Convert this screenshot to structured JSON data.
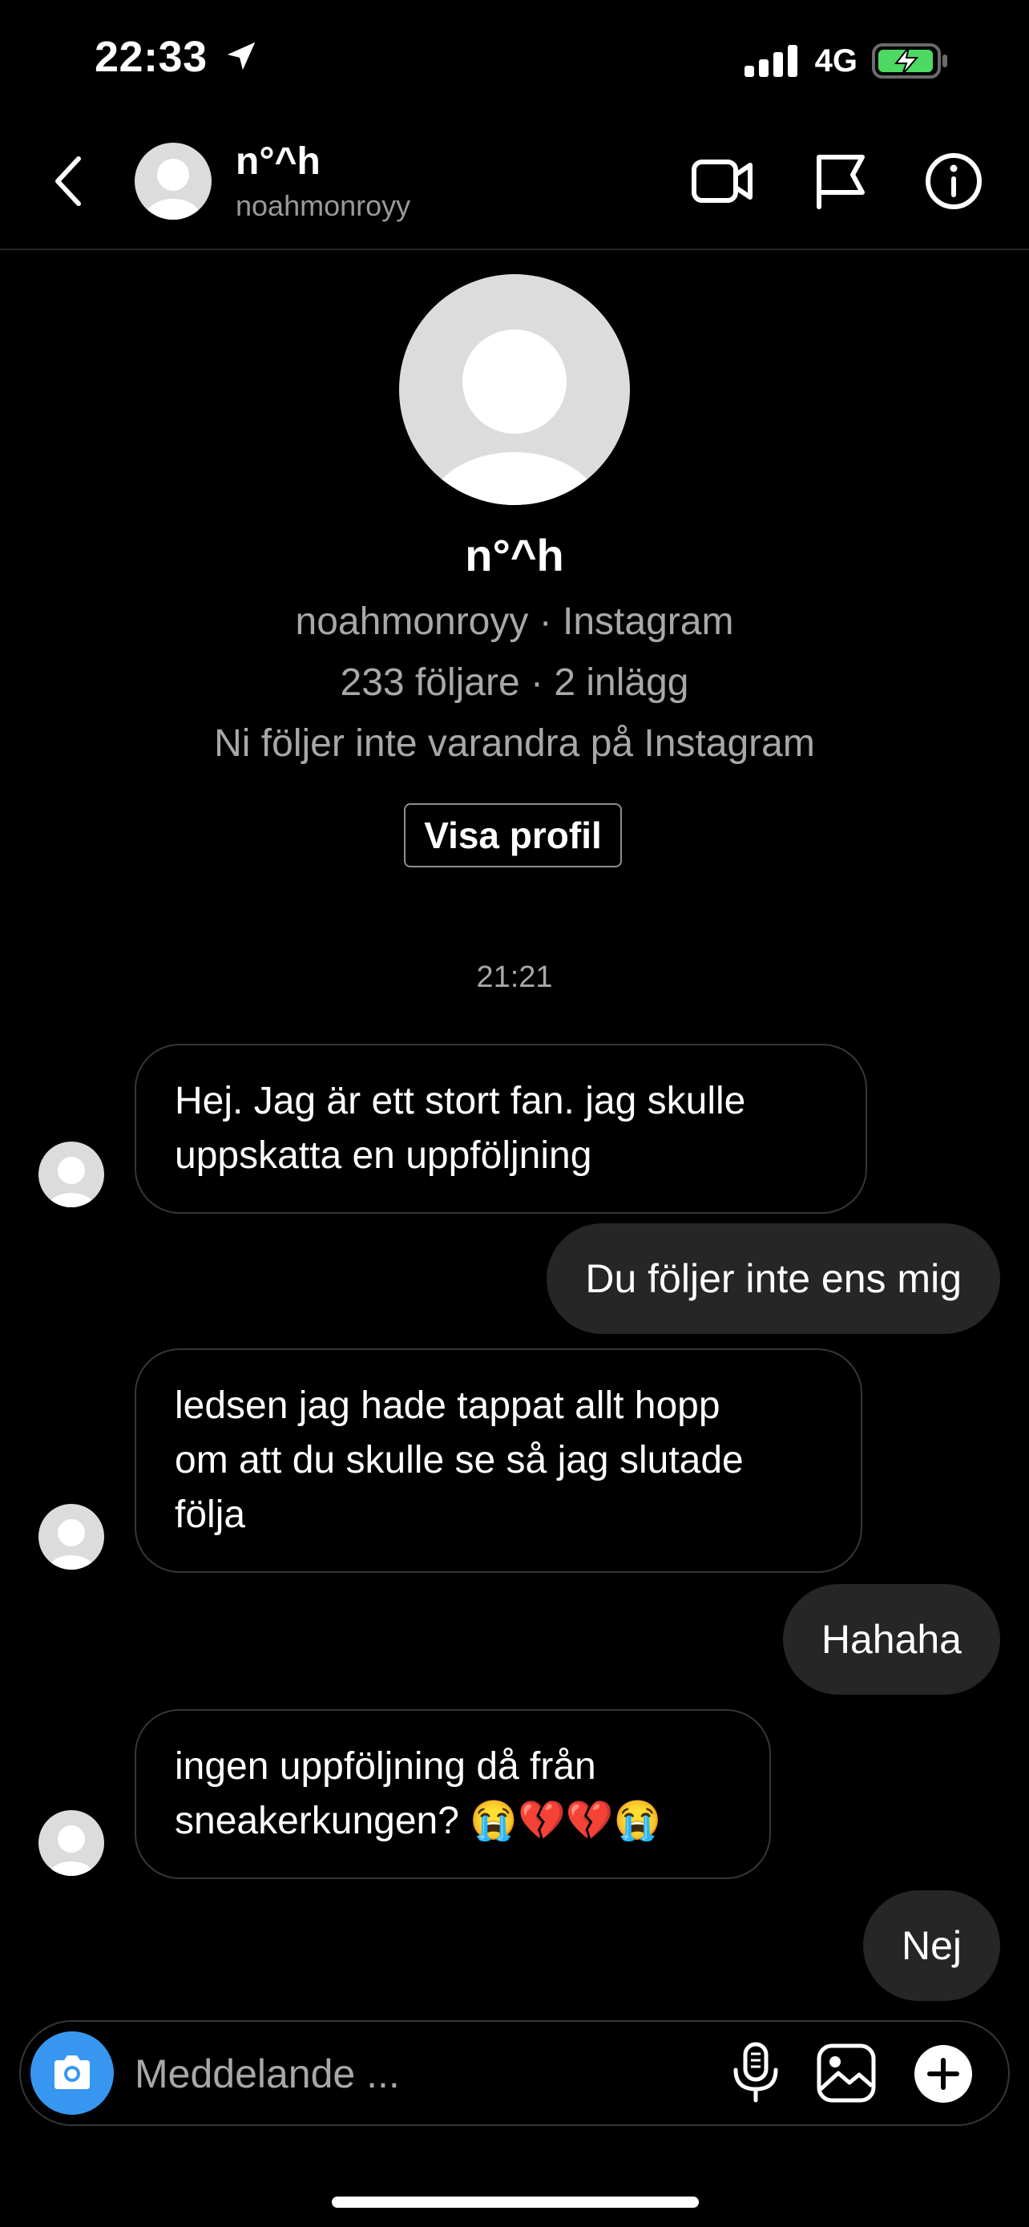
{
  "status_bar": {
    "time": "22:33",
    "network": "4G"
  },
  "header": {
    "name": "n°^h",
    "username": "noahmonroyy"
  },
  "profile": {
    "name": "n°^h",
    "line1": "noahmonroyy · Instagram",
    "line2": "233 följare · 2 inlägg",
    "line3": "Ni följer inte varandra på Instagram",
    "view_profile_label": "Visa profil"
  },
  "conversation": {
    "timestamp": "21:21",
    "messages": [
      {
        "from": "them",
        "line1": "Hej. Jag är ett stort fan. jag skulle",
        "line2": "uppskatta en uppföljning"
      },
      {
        "from": "me",
        "text": "Du följer inte ens mig"
      },
      {
        "from": "them",
        "line1": "ledsen jag hade tappat allt hopp",
        "line2": "om att du skulle se så jag slutade",
        "line3": "följa"
      },
      {
        "from": "me",
        "text": "Hahaha"
      },
      {
        "from": "them",
        "line1": "ingen uppföljning då från",
        "line2": "sneakerkungen? 😭💔💔😭"
      },
      {
        "from": "me",
        "text": "Nej"
      }
    ]
  },
  "composer": {
    "placeholder": "Meddelande ..."
  },
  "colors": {
    "camera": "#3797f0",
    "outgoing_bubble": "#262626",
    "battery_charge": "#4cd964"
  }
}
